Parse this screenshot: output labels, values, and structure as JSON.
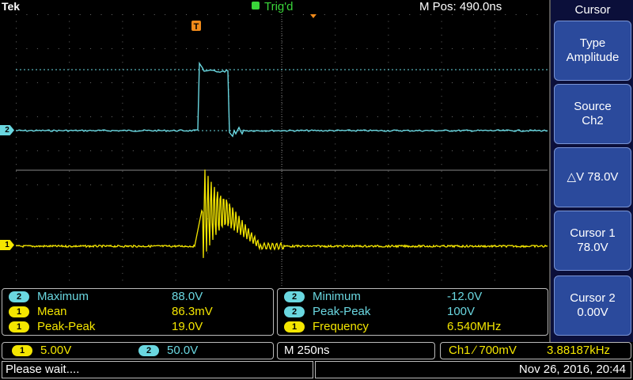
{
  "header": {
    "brand": "Tek",
    "trigger_status": "Trig'd",
    "position": "M Pos: 490.0ns"
  },
  "menu": {
    "title": "Cursor",
    "buttons": [
      {
        "line1": "Type",
        "line2": "Amplitude"
      },
      {
        "line1": "Source",
        "line2": "Ch2"
      },
      {
        "line1": "△V 78.0V",
        "line2": ""
      },
      {
        "line1": "Cursor 1",
        "line2": "78.0V"
      },
      {
        "line1": "Cursor 2",
        "line2": "0.00V"
      }
    ]
  },
  "measurements_left": [
    {
      "ch": "2",
      "name": "Maximum",
      "value": "88.0V"
    },
    {
      "ch": "1",
      "name": "Mean",
      "value": "86.3mV"
    },
    {
      "ch": "1",
      "name": "Peak-Peak",
      "value": "19.0V"
    }
  ],
  "measurements_right": [
    {
      "ch": "2",
      "name": "Minimum",
      "value": "-12.0V"
    },
    {
      "ch": "2",
      "name": "Peak-Peak",
      "value": "100V"
    },
    {
      "ch": "1",
      "name": "Frequency",
      "value": "6.540MHz"
    }
  ],
  "channels": {
    "ch1_scale": "5.00V",
    "ch2_scale": "50.0V",
    "ch1_label": "1",
    "ch2_label": "2",
    "timebase": "M 250ns",
    "trigger_setting": "Ch1 ∕ 700mV",
    "trigger_freq": "3.88187kHz"
  },
  "status": {
    "message": "Please wait....",
    "datetime": "Nov 26, 2016, 20:44"
  },
  "markers": {
    "trigger_marker": "T"
  },
  "colors": {
    "ch1": "#f4e600",
    "ch2": "#6ad7e0",
    "menu_button": "#2b4a9c",
    "trig": "#3ad63a",
    "trig_marker": "#f08a1a"
  }
}
